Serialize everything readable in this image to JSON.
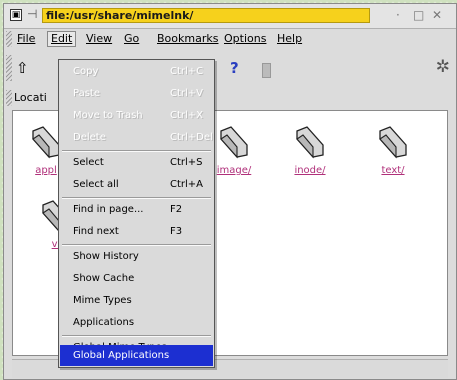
{
  "window": {
    "title": "file:/usr/share/mimelnk/",
    "icon_glyph": "▣",
    "pin_glyph": "⊣",
    "min_glyph": "·",
    "max_glyph": "□",
    "close_glyph": "✕"
  },
  "menubar": {
    "items": [
      {
        "label": "File",
        "underline_index": 0
      },
      {
        "label": "Edit",
        "underline_index": 0
      },
      {
        "label": "View",
        "underline_index": 0
      },
      {
        "label": "Go",
        "underline_index": 0
      },
      {
        "label": "Bookmarks",
        "underline_index": 0
      },
      {
        "label": "Options",
        "underline_index": 0
      },
      {
        "label": "Help",
        "underline_index": 0
      }
    ]
  },
  "toolbar": {
    "up_glyph": "⇧",
    "help_glyph": "?",
    "gear_glyph": "✲"
  },
  "location": {
    "label": "Locati"
  },
  "folders": {
    "row1": [
      "appl",
      "image/",
      "inode/",
      "text/"
    ],
    "row2": [
      "vi"
    ]
  },
  "edit_menu": {
    "copy": {
      "label": "Copy",
      "accel": "Ctrl+C"
    },
    "paste": {
      "label": "Paste",
      "accel": "Ctrl+V"
    },
    "move_to_trash": {
      "label": "Move to Trash",
      "accel": "Ctrl+X"
    },
    "delete": {
      "label": "Delete",
      "accel": "Ctrl+Del"
    },
    "select": {
      "label": "Select",
      "accel": "Ctrl+S"
    },
    "select_all": {
      "label": "Select all",
      "accel": "Ctrl+A"
    },
    "find_in_page": {
      "label": "Find in page...",
      "accel": "F2"
    },
    "find_next": {
      "label": "Find next",
      "accel": "F3"
    },
    "show_history": {
      "label": "Show History"
    },
    "show_cache": {
      "label": "Show Cache"
    },
    "mime_types": {
      "label": "Mime Types"
    },
    "applications": {
      "label": "Applications"
    },
    "global_mime_types": {
      "label": "Global Mime Types"
    },
    "global_applications": {
      "label": "Global Applications"
    }
  },
  "colors": {
    "title_highlight": "#f6d11c",
    "menu_selection": "#1c2fd1",
    "folder_link": "#b0307a",
    "desktop": "#cfe1bf"
  },
  "icons": {
    "folder": "folder-icon",
    "up": "up-arrow-icon",
    "help": "help-icon",
    "trash": "trash-icon",
    "gear": "gear-icon"
  }
}
